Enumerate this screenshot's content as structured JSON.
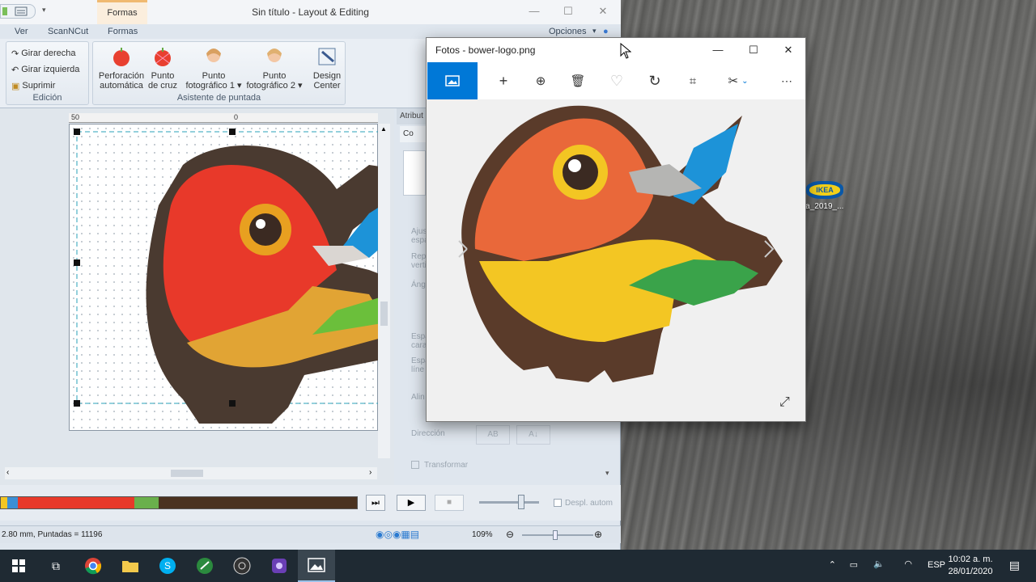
{
  "desktop": {
    "icon_label": "ea_2019_...",
    "icon_logo_text": "IKEA"
  },
  "app": {
    "title": "Sin título - Layout & Editing",
    "context_tab": "Formas",
    "tabs": [
      "Ver",
      "ScanNCut",
      "Formas"
    ],
    "options_label": "Opciones",
    "ribbon": {
      "edicion": {
        "label": "Edición",
        "items": [
          "Girar derecha",
          "Girar izquierda",
          "Suprimir"
        ]
      },
      "asistente": {
        "label": "Asistente de puntada",
        "buttons": [
          {
            "line1": "Perforación",
            "line2": "automática"
          },
          {
            "line1": "Punto",
            "line2": "de cruz"
          },
          {
            "line1": "Punto",
            "line2": "fotográfico 1"
          },
          {
            "line1": "Punto",
            "line2": "fotográfico 2"
          },
          {
            "line1": "Design",
            "line2": "Center"
          }
        ]
      }
    },
    "ruler": {
      "left": "50",
      "mid": "0"
    },
    "attributes_header": "Atribut",
    "attributes_tab": "Co",
    "attributes": {
      "rows": [
        "Ajus",
        "espa",
        "Rep",
        "verti",
        "Ángu",
        "Espa",
        "cara",
        "Espa",
        "líne",
        "Alin"
      ],
      "direction": "Dirección",
      "transform": "Transformar",
      "dir_btn1": "AB",
      "dir_btn2": "A↓"
    },
    "timeline": {
      "colors": [
        {
          "color": "#f3c623",
          "flex": 2
        },
        {
          "color": "#3b8fd6",
          "flex": 3
        },
        {
          "color": "#e8392a",
          "flex": 34
        },
        {
          "color": "#6ab04c",
          "flex": 7
        },
        {
          "color": "#4a3220",
          "flex": 58
        }
      ],
      "checkbox_label": "Despl. autom"
    },
    "status": {
      "left": "2.80 mm, Puntadas = 11196",
      "zoom": "109%"
    }
  },
  "photos": {
    "title": "Fotos - bower-logo.png",
    "toolbar_icons": [
      "view-image-icon",
      "add-icon",
      "zoom-icon",
      "delete-icon",
      "heart-icon",
      "rotate-icon",
      "crop-icon",
      "edit-icon",
      "more-icon"
    ]
  },
  "taskbar": {
    "language": "ESP",
    "time": "10:02 a. m.",
    "date": "28/01/2020"
  },
  "colors": {
    "photos_accent": "#0078d7",
    "bird_orange": "#e9683a",
    "bird_red": "#e8392a",
    "bird_yellow": "#f3c623",
    "bird_green": "#3aa34a",
    "bird_blue": "#1d93d8",
    "bird_brown": "#5a3b2a"
  }
}
